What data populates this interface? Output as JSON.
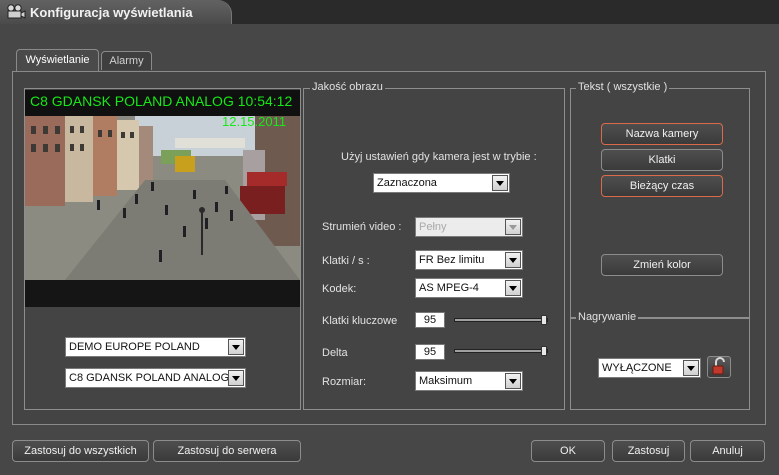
{
  "window": {
    "title": "Konfiguracja wyświetlania",
    "title_icon": "camera-icon"
  },
  "tabs": [
    {
      "label": "Wyświetlanie",
      "active": true
    },
    {
      "label": "Alarmy",
      "active": false
    }
  ],
  "preview": {
    "osd_line1": "C8 GDANSK POLAND ANALOG  10:54:12",
    "osd_line2": "12.15.2011",
    "osd_color": "#17e817"
  },
  "server_select": {
    "value": "DEMO EUROPE POLAND"
  },
  "camera_select": {
    "value": "C8 GDANSK POLAND ANALOG"
  },
  "quality": {
    "title": "Jakość obrazu",
    "mode_prompt": "Użyj ustawień gdy kamera jest w trybie :",
    "mode_value": "Zaznaczona",
    "stream_label": "Strumień video :",
    "stream_value": "Pełny",
    "fps_label": "Klatki / s :",
    "fps_value": "FR Bez limitu",
    "codec_label": "Kodek:",
    "codec_value": "AS MPEG-4",
    "keyframes_label": "Klatki kluczowe",
    "keyframes_value": "95",
    "keyframes_level": 1.0,
    "delta_label": "Delta",
    "delta_value": "95",
    "delta_level": 1.0,
    "size_label": "Rozmiar:",
    "size_value": "Maksimum"
  },
  "text_panel": {
    "title": "Tekst ( wszystkie )",
    "camera_name_button": "Nazwa kamery",
    "frames_button": "Klatki",
    "current_time_button": "Bieżący czas",
    "change_color_button": "Zmień kolor",
    "active_border_color": "#d96a4a"
  },
  "recording": {
    "title": "Nagrywanie",
    "value": "WYŁĄCZONE",
    "lock_icon": "padlock-open-icon"
  },
  "footer": {
    "apply_all": "Zastosuj do wszystkich",
    "apply_server": "Zastosuj do serwera",
    "ok": "OK",
    "apply": "Zastosuj",
    "cancel": "Anuluj"
  }
}
